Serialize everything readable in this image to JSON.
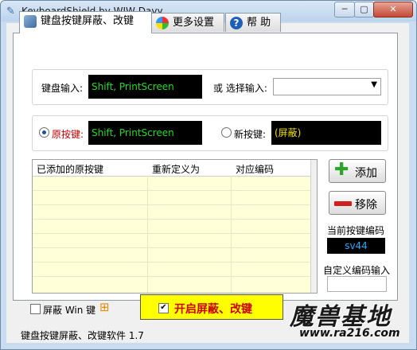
{
  "window": {
    "title": "KeyboardShield by WJW-Davy",
    "min_icon": "minimize-icon",
    "max_icon": "maximize-icon",
    "close_icon": "close-icon"
  },
  "tabs": [
    {
      "label": "键盘按键屏蔽、改键",
      "icon": "keyboard-icon",
      "active": true
    },
    {
      "label": "更多设置",
      "icon": "settings-globe-icon",
      "active": false
    },
    {
      "label": "帮 助",
      "icon": "help-icon",
      "active": false
    }
  ],
  "keyboard_input": {
    "label": "键盘输入:",
    "value": "Shift, PrintScreen",
    "or_label": "或 选择输入:",
    "select_value": ""
  },
  "original_key": {
    "label": "原按键:",
    "value": "Shift, PrintScreen",
    "selected": true
  },
  "new_key": {
    "label": "新按键:",
    "value": "(屏蔽)",
    "selected": false
  },
  "table": {
    "columns": [
      "已添加的原按键",
      "重新定义为",
      "对应编码"
    ],
    "rows": []
  },
  "buttons": {
    "add": "添加",
    "remove": "移除",
    "start": "开启屏蔽、改键"
  },
  "current_code": {
    "label": "当前按键编码",
    "value": "sv44"
  },
  "custom_code": {
    "label": "自定义编码输入",
    "value": ""
  },
  "block_win": {
    "label": "屏蔽 Win 键",
    "checked": false
  },
  "status_bar": "键盘按键屏蔽、改键软件 1.7",
  "watermark": {
    "main": "魔兽基地",
    "url": "www.ra216.com"
  },
  "colors": {
    "input_bg": "#000000",
    "input_text": "#22dd22",
    "new_key_text": "#f0e000",
    "code_text": "#22aaff",
    "start_bg": "#ffff00",
    "start_text": "#cc0000",
    "list_bg": "#ffffd8"
  }
}
